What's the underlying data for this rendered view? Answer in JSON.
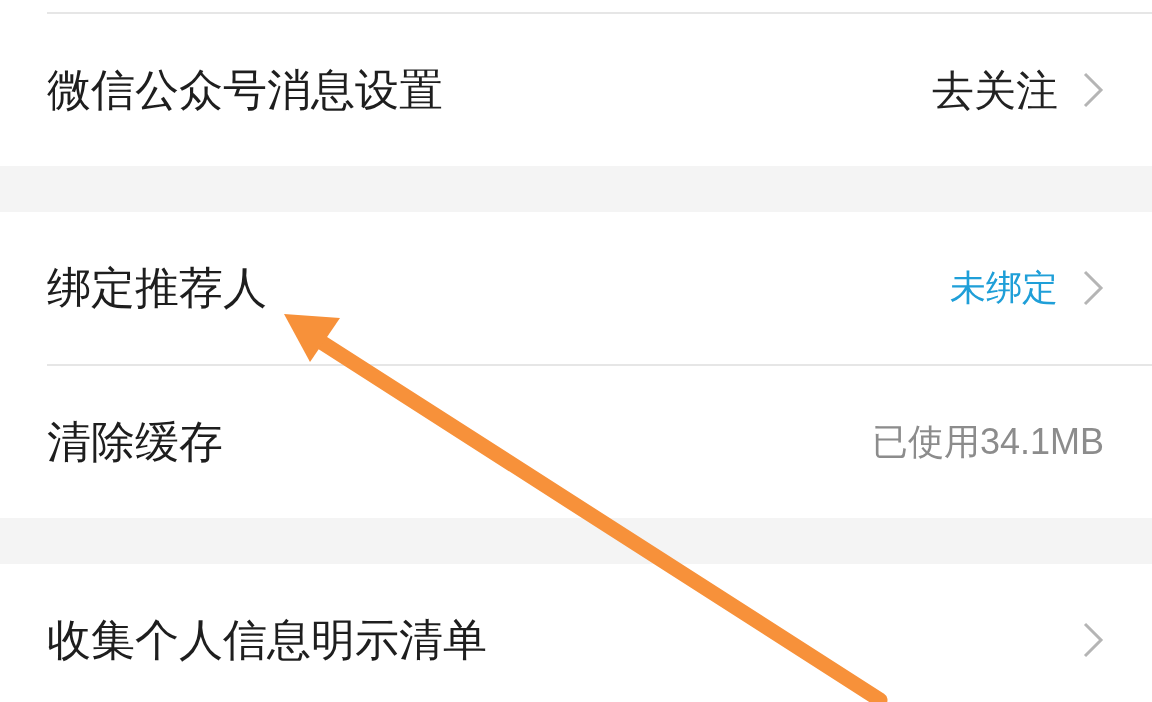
{
  "groups": [
    {
      "items": [
        {
          "label": "微信公众号消息设置",
          "value": "去关注",
          "kind": "normal",
          "chevron": true
        }
      ]
    },
    {
      "items": [
        {
          "label": "绑定推荐人",
          "value": "未绑定",
          "kind": "link",
          "chevron": true
        },
        {
          "label": "清除缓存",
          "value": "已使用34.1MB",
          "kind": "muted",
          "chevron": false
        }
      ]
    },
    {
      "items": [
        {
          "label": "收集个人信息明示清单",
          "chevron": true
        }
      ]
    }
  ],
  "annotations": [
    {
      "kind": "arrow"
    }
  ]
}
